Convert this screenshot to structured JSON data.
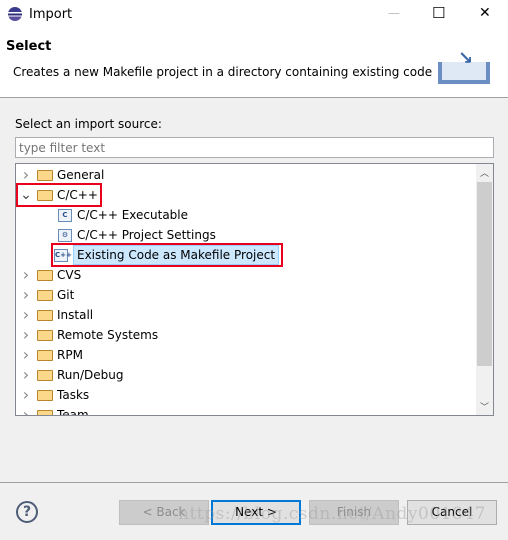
{
  "window": {
    "title": "Import",
    "minimize": "—",
    "maximize": "☐",
    "close": "✕"
  },
  "header": {
    "title": "Select",
    "description": "Creates a new Makefile project in a directory containing existing code"
  },
  "main": {
    "label": "Select an import source:",
    "filter_placeholder": "type filter text",
    "filter_value": ""
  },
  "tree": [
    {
      "label": "General",
      "type": "folder",
      "expanded": false
    },
    {
      "label": "C/C++",
      "type": "folder",
      "expanded": true,
      "highlighted": true
    },
    {
      "label": "C/C++ Executable",
      "type": "leaf",
      "icon": "C"
    },
    {
      "label": "C/C++ Project Settings",
      "type": "leaf",
      "icon": "settings"
    },
    {
      "label": "Existing Code as Makefile Project",
      "type": "leaf",
      "icon": "C++",
      "selected": true,
      "highlighted": true
    },
    {
      "label": "CVS",
      "type": "folder"
    },
    {
      "label": "Git",
      "type": "folder"
    },
    {
      "label": "Install",
      "type": "folder"
    },
    {
      "label": "Remote Systems",
      "type": "folder"
    },
    {
      "label": "RPM",
      "type": "folder"
    },
    {
      "label": "Run/Debug",
      "type": "folder"
    },
    {
      "label": "Tasks",
      "type": "folder"
    },
    {
      "label": "Team",
      "type": "folder"
    }
  ],
  "buttons": {
    "back": "< Back",
    "next": "Next >",
    "finish": "Finish",
    "cancel": "Cancel",
    "help": "?"
  },
  "watermark": "https://blog.csdn.net/Andy001847",
  "colors": {
    "highlight": "#e8001c",
    "selection": "#cce8ff",
    "focus": "#0078d7"
  }
}
